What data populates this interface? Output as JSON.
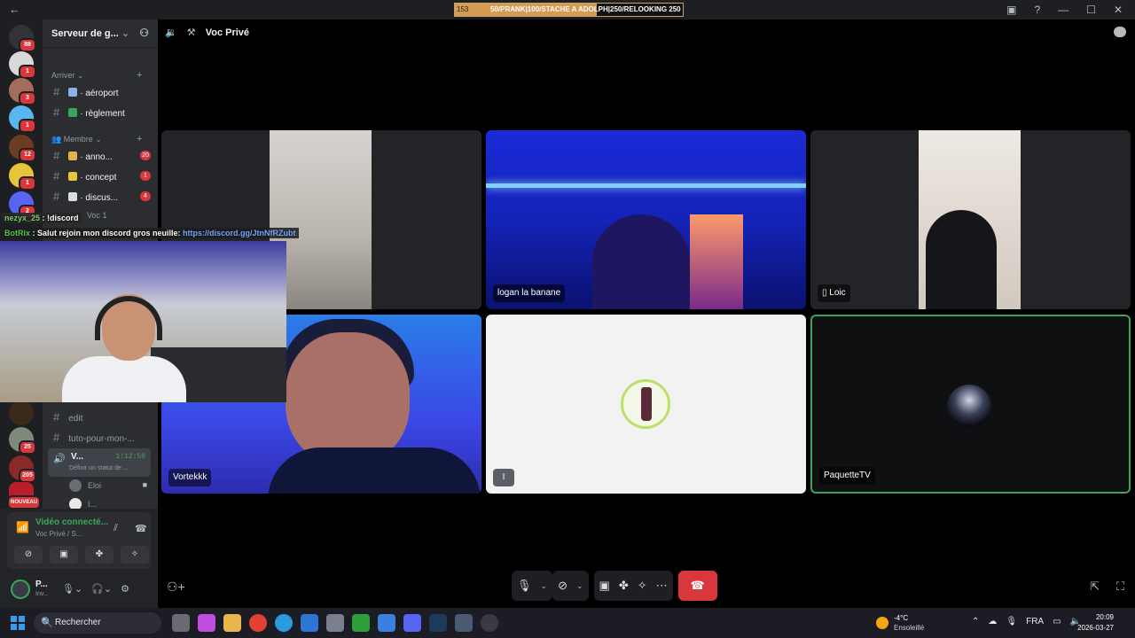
{
  "stream_title": {
    "prefix": "153",
    "text": "50/PRANK|100/STACHE A ADOLPH|250/RELOOKING 250"
  },
  "server": {
    "name": "Serveur de g..."
  },
  "categories": {
    "arriver": "Arriver",
    "membre": "Membre"
  },
  "channels": [
    {
      "name": "aéroport",
      "count": ""
    },
    {
      "name": "règlement",
      "count": ""
    },
    {
      "name": "anno...",
      "count": "20"
    },
    {
      "name": "concept",
      "count": "1"
    },
    {
      "name": "discus...",
      "count": "4"
    },
    {
      "name": "edit",
      "count": ""
    },
    {
      "name": "tuto-pour-mon-...",
      "count": ""
    }
  ],
  "voice_channel_partial": "Voc 1",
  "active_voice": {
    "name": "V...",
    "timer": "1:12:59",
    "status": "Définir un statut de ..."
  },
  "voice_members": [
    {
      "name": "Eloi"
    },
    {
      "name": "I..."
    }
  ],
  "server_badges": [
    "88",
    "1",
    "3",
    "1",
    "12",
    "1",
    "2",
    "25",
    "205",
    "NOUVEAU"
  ],
  "chat_overlay": {
    "line1_user": "nezyx_25",
    "line1_msg": " : !discord",
    "line2_user": "BotRix",
    "line2_msg": " : Salut rejoin mon discord gros neuille: ",
    "line2_link": "https://discord.gg/JtnNfRZubt"
  },
  "call": {
    "channel_title": "Voc Privé",
    "participants": [
      {
        "name": ""
      },
      {
        "name": "logan la banane"
      },
      {
        "name": "Loic"
      },
      {
        "name": "Vortekkk"
      },
      {
        "name": "I"
      },
      {
        "name": "PaquetteTV"
      }
    ]
  },
  "voice_panel": {
    "status": "Vidéo connecté...",
    "sub": "Voc Privé / S..."
  },
  "user_panel": {
    "name": "P...",
    "status": "Inv..."
  },
  "taskbar": {
    "search": "Rechercher",
    "weather_temp": "-4°C",
    "weather_desc": "Ensoleillé",
    "lang": "FRA",
    "time": "20:09",
    "date": "2026-03-27"
  },
  "colors": {
    "accent_green": "#3ba55d",
    "danger": "#da373c",
    "bg_dark": "#1e1f22"
  }
}
